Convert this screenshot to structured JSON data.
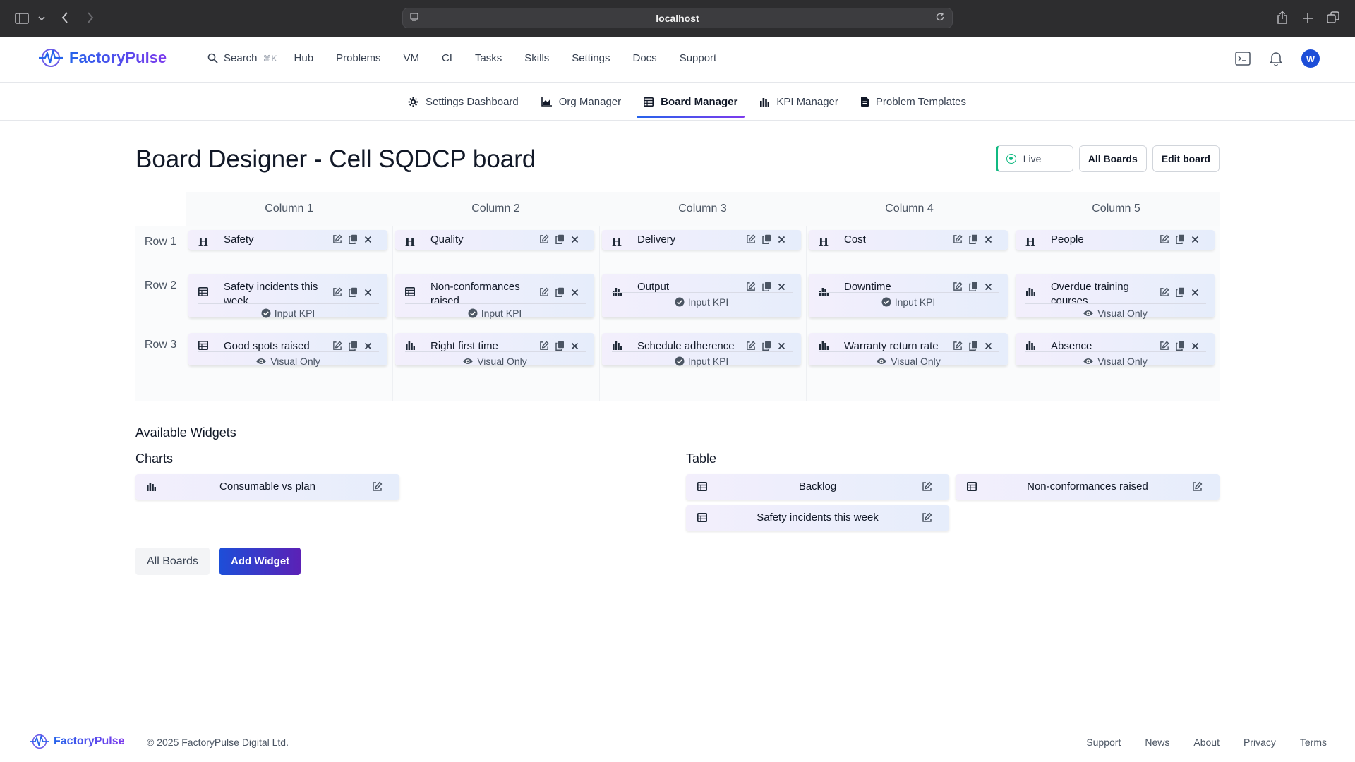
{
  "browser": {
    "url": "localhost"
  },
  "header": {
    "brand": "FactoryPulse",
    "search_label": "Search",
    "search_shortcut": "⌘K",
    "nav": [
      "Hub",
      "Problems",
      "VM",
      "CI",
      "Tasks",
      "Skills",
      "Settings",
      "Docs",
      "Support"
    ],
    "avatar_initial": "W"
  },
  "subnav": {
    "tabs": [
      {
        "label": "Settings Dashboard",
        "icon": "gear-icon"
      },
      {
        "label": "Org Manager",
        "icon": "area-chart-icon"
      },
      {
        "label": "Board Manager",
        "icon": "table-icon",
        "active": true
      },
      {
        "label": "KPI Manager",
        "icon": "bar-chart-icon"
      },
      {
        "label": "Problem Templates",
        "icon": "document-icon"
      }
    ]
  },
  "page": {
    "title": "Board Designer - Cell SQDCP board",
    "live_label": "Live",
    "all_boards_label": "All Boards",
    "edit_board_label": "Edit board"
  },
  "grid": {
    "columns": [
      "Column 1",
      "Column 2",
      "Column 3",
      "Column 4",
      "Column 5"
    ],
    "rows": [
      "Row 1",
      "Row 2",
      "Row 3"
    ],
    "widgets": [
      [
        {
          "type": "heading",
          "title": "Safety",
          "footer": ""
        },
        {
          "type": "heading",
          "title": "Quality",
          "footer": ""
        },
        {
          "type": "heading",
          "title": "Delivery",
          "footer": ""
        },
        {
          "type": "heading",
          "title": "Cost",
          "footer": ""
        },
        {
          "type": "heading",
          "title": "People",
          "footer": ""
        }
      ],
      [
        {
          "type": "table",
          "title": "Safety incidents this week",
          "footer": "Input KPI",
          "footer_icon": "check-circle-icon"
        },
        {
          "type": "table",
          "title": "Non-conformances raised",
          "footer": "Input KPI",
          "footer_icon": "check-circle-icon"
        },
        {
          "type": "chart",
          "title": "Output",
          "footer": "Input KPI",
          "footer_icon": "check-circle-icon"
        },
        {
          "type": "chart",
          "title": "Downtime",
          "footer": "Input KPI",
          "footer_icon": "check-circle-icon"
        },
        {
          "type": "chart",
          "title": "Overdue training courses",
          "footer": "Visual Only",
          "footer_icon": "eye-icon"
        }
      ],
      [
        {
          "type": "table",
          "title": "Good spots raised",
          "footer": "Visual Only",
          "footer_icon": "eye-icon"
        },
        {
          "type": "chart",
          "title": "Right first time",
          "footer": "Visual Only",
          "footer_icon": "eye-icon"
        },
        {
          "type": "chart",
          "title": "Schedule adherence",
          "footer": "Input KPI",
          "footer_icon": "check-circle-icon"
        },
        {
          "type": "chart",
          "title": "Warranty return rate",
          "footer": "Visual Only",
          "footer_icon": "eye-icon"
        },
        {
          "type": "chart",
          "title": "Absence",
          "footer": "Visual Only",
          "footer_icon": "eye-icon"
        }
      ]
    ]
  },
  "available": {
    "title": "Available Widgets",
    "charts_title": "Charts",
    "charts": [
      "Consumable vs plan"
    ],
    "table_title": "Table",
    "tables": [
      "Backlog",
      "Non-conformances raised",
      "Safety incidents this week"
    ]
  },
  "actions": {
    "all_boards": "All Boards",
    "add_widget": "Add Widget"
  },
  "footer": {
    "brand": "FactoryPulse",
    "copyright": "© 2025 FactoryPulse Digital Ltd.",
    "links": [
      "Support",
      "News",
      "About",
      "Privacy",
      "Terms"
    ]
  },
  "colors": {
    "accent": "#2563eb",
    "accent2": "#7c3aed",
    "live": "#10b981"
  }
}
